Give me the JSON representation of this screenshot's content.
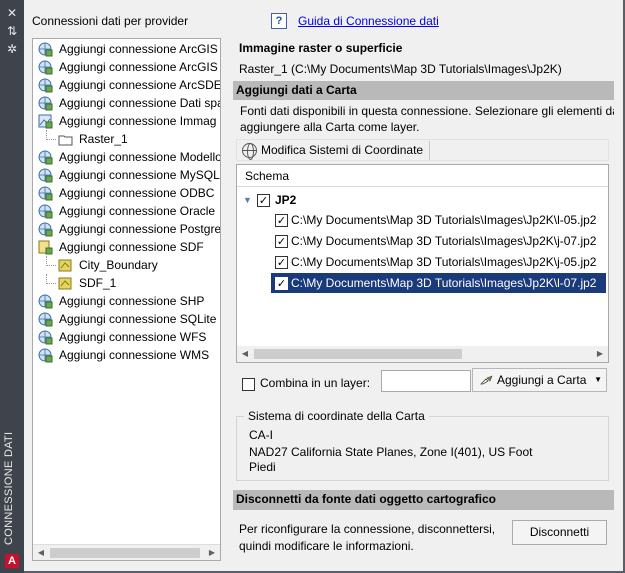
{
  "sidebar": {
    "title": "CONNESSIONE DATI",
    "logo": "A"
  },
  "left_panel": {
    "title": "Connessioni dati per provider",
    "items": [
      {
        "label": "Aggiungi connessione ArcGIS",
        "icon": "globe-connection-icon"
      },
      {
        "label": "Aggiungi connessione ArcGIS",
        "icon": "globe-connection-icon"
      },
      {
        "label": "Aggiungi connessione ArcSDE",
        "icon": "globe-connection-icon"
      },
      {
        "label": "Aggiungi connessione Dati spa",
        "icon": "globe-connection-icon"
      },
      {
        "label": "Aggiungi connessione Immag",
        "icon": "raster-connection-icon"
      },
      {
        "label": "Raster_1",
        "icon": "folder-icon"
      },
      {
        "label": "Aggiungi connessione Modello",
        "icon": "globe-connection-icon"
      },
      {
        "label": "Aggiungi connessione MySQL",
        "icon": "globe-connection-icon"
      },
      {
        "label": "Aggiungi connessione ODBC",
        "icon": "globe-connection-icon"
      },
      {
        "label": "Aggiungi connessione Oracle",
        "icon": "globe-connection-icon"
      },
      {
        "label": "Aggiungi connessione Postgre",
        "icon": "globe-connection-icon"
      },
      {
        "label": "Aggiungi connessione SDF",
        "icon": "sdf-connection-icon"
      },
      {
        "label": "City_Boundary",
        "icon": "sdf-file-icon"
      },
      {
        "label": "SDF_1",
        "icon": "sdf-file-icon"
      },
      {
        "label": "Aggiungi connessione SHP",
        "icon": "globe-connection-icon"
      },
      {
        "label": "Aggiungi connessione SQLite",
        "icon": "globe-connection-icon"
      },
      {
        "label": "Aggiungi connessione WFS",
        "icon": "globe-connection-icon"
      },
      {
        "label": "Aggiungi connessione WMS",
        "icon": "globe-connection-icon"
      }
    ]
  },
  "right_panel": {
    "help_link": "Guida di Connessione dati",
    "raster_title": "Immagine raster o superficie",
    "raster_value": "Raster_1 (C:\\My Documents\\Map 3D Tutorials\\Images\\Jp2K)",
    "add_section": {
      "header": "Aggiungi dati a Carta",
      "desc_line1": "Fonti dati disponibili in questa connessione. Selezionare gli elementi da",
      "desc_line2": "aggiungere alla Carta come layer.",
      "coord_button": "Modifica Sistemi di Coordinate",
      "schema_header": "Schema",
      "schema_root": "JP2",
      "schema_items": [
        "C:\\My Documents\\Map 3D Tutorials\\Images\\Jp2K\\l-05.jp2",
        "C:\\My Documents\\Map 3D Tutorials\\Images\\Jp2K\\j-07.jp2",
        "C:\\My Documents\\Map 3D Tutorials\\Images\\Jp2K\\j-05.jp2",
        "C:\\My Documents\\Map 3D Tutorials\\Images\\Jp2K\\l-07.jp2"
      ],
      "combine_label": "Combina in un layer:",
      "combine_value": "",
      "add_button": "Aggiungi a Carta"
    },
    "coord_system": {
      "title": "Sistema di coordinate della Carta",
      "code": "CA-I",
      "description": "NAD27 California State Planes, Zone I(401), US Foot",
      "unit": "Piedi"
    },
    "disconnect_section": {
      "header": "Disconnetti da fonte dati oggetto cartografico",
      "text_line1": "Per riconfigurare la connessione, disconnettersi,",
      "text_line2": "quindi modificare le informazioni.",
      "button": "Disconnetti"
    }
  }
}
